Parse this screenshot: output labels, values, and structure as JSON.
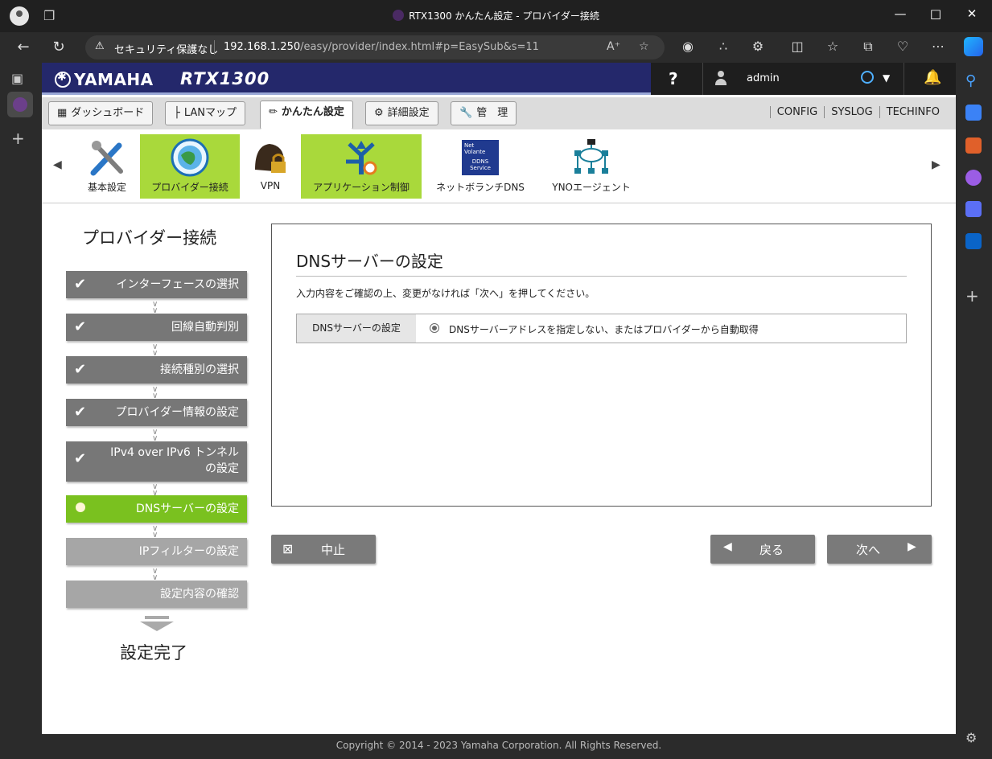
{
  "browser": {
    "window_title": "RTX1300 かんたん設定 - プロバイダー接続",
    "security_label": "セキュリティ保護なし",
    "url_host": "192.168.1.250",
    "url_path": "/easy/provider/index.html#p=EasySub&s=11"
  },
  "header": {
    "brand": "YAMAHA",
    "model": "RTX1300",
    "help": "?",
    "user": "admin"
  },
  "menu": {
    "tabs": [
      {
        "label": "ダッシュボード"
      },
      {
        "label": "LANマップ"
      },
      {
        "label": "かんたん設定"
      },
      {
        "label": "詳細設定"
      },
      {
        "label": "管　理"
      }
    ],
    "links": [
      "CONFIG",
      "SYSLOG",
      "TECHINFO"
    ]
  },
  "icons": [
    {
      "label": "基本設定"
    },
    {
      "label": "プロバイダー接続"
    },
    {
      "label": "VPN"
    },
    {
      "label": "アプリケーション制御"
    },
    {
      "label": "ネットボランチDNS"
    },
    {
      "label": "YNOエージェント"
    }
  ],
  "ddns_icon_text": [
    "Net",
    "Volante",
    "DDNS",
    "Service"
  ],
  "wizard": {
    "title": "プロバイダー接続",
    "steps": [
      {
        "label": "インターフェースの選択"
      },
      {
        "label": "回線自動判別"
      },
      {
        "label": "接続種別の選択"
      },
      {
        "label": "プロバイダー情報の設定"
      },
      {
        "label_line1": "IPv4 over IPv6 トンネル",
        "label_line2": "の設定"
      },
      {
        "label": "DNSサーバーの設定"
      },
      {
        "label": "IPフィルターの設定"
      },
      {
        "label": "設定内容の確認"
      }
    ],
    "finish": "設定完了"
  },
  "main": {
    "title": "DNSサーバーの設定",
    "description": "入力内容をご確認の上、変更がなければ「次へ」を押してください。",
    "row_key": "DNSサーバーの設定",
    "row_value": "DNSサーバーアドレスを指定しない、またはプロバイダーから自動取得"
  },
  "buttons": {
    "cancel": "中止",
    "back": "戻る",
    "next": "次へ"
  },
  "footer": "Copyright © 2014 - 2023 Yamaha Corporation. All Rights Reserved.",
  "colors": {
    "header_bg": "#24286b",
    "highlight_green": "#a9d93b",
    "current_step": "#7ac11f",
    "done_step": "#777777",
    "todo_step": "#a6a6a6"
  }
}
